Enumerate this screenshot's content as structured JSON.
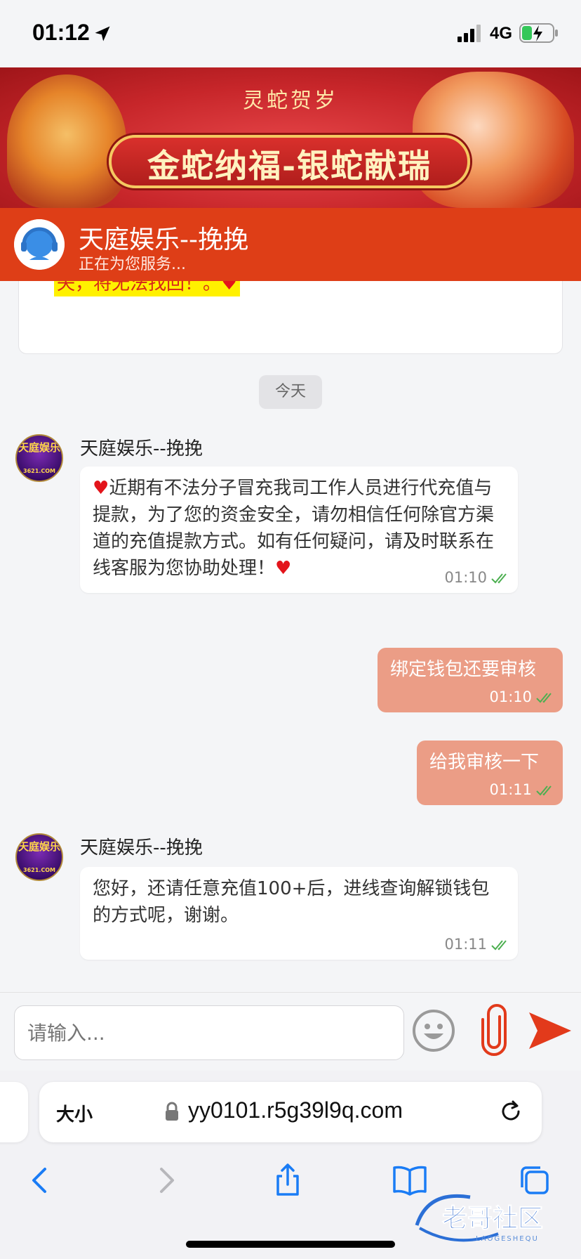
{
  "status_bar": {
    "time": "01:12",
    "network": "4G"
  },
  "banner": {
    "subtitle": "灵蛇贺岁",
    "title": "金蛇纳福-银蛇献瑞"
  },
  "chat_header": {
    "agent_name": "天庭娱乐--挽挽",
    "status": "正在为您服务..."
  },
  "chat": {
    "notice_tail": "失，将无法找回！。",
    "day_separator": "今天",
    "messages": [
      {
        "direction": "in",
        "sender": "天庭娱乐--挽挽",
        "avatar_text": "天庭娱乐",
        "avatar_sub": "3621.COM",
        "text": "近期有不法分子冒充我司工作人员进行代充值与提款，为了您的资金安全，请勿相信任何除官方渠道的充值提款方式。如有任何疑问，请及时联系在线客服为您协助处理！",
        "time": "01:10"
      },
      {
        "direction": "out",
        "text": "绑定钱包还要审核",
        "time": "01:10"
      },
      {
        "direction": "out",
        "text": "给我审核一下",
        "time": "01:11"
      },
      {
        "direction": "in",
        "sender": "天庭娱乐--挽挽",
        "avatar_text": "天庭娱乐",
        "avatar_sub": "3621.COM",
        "text": "您好，还请任意充值100+后，进线查询解锁钱包的方式呢，谢谢。",
        "time": "01:11"
      }
    ]
  },
  "input": {
    "placeholder": "请输入..."
  },
  "browser": {
    "text_size_label": "大小",
    "url": "yy0101.r5g39l9q.com"
  },
  "watermark": {
    "text": "老哥社区",
    "sub": "LAOGESHEQU"
  },
  "colors": {
    "header": "#de3e17",
    "outgoing_bubble": "#eb9d86",
    "send": "#e23a1b",
    "read_tick": "#4caf50"
  }
}
